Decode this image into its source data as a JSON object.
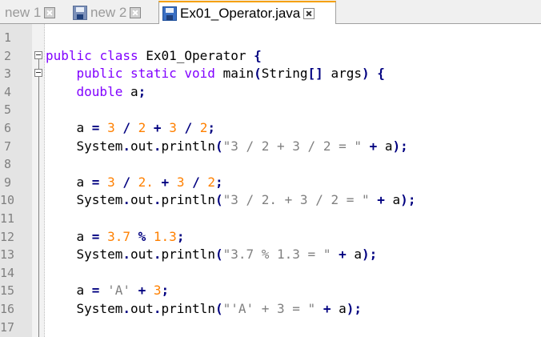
{
  "tabs": [
    {
      "label": "new 1",
      "icon": "close-icon",
      "active": false
    },
    {
      "label": "new 2",
      "icon": "save-icon",
      "active": false
    },
    {
      "label": "Ex01_Operator.java",
      "icon": "save-icon",
      "active": true
    }
  ],
  "editor": {
    "line_numbers": [
      "1",
      "2",
      "3",
      "4",
      "5",
      "6",
      "7",
      "8",
      "9",
      "10",
      "11",
      "12",
      "13",
      "14",
      "15",
      "16",
      "17"
    ],
    "code": {
      "l2": {
        "kw1": "public",
        "kw2": "class",
        "name": " Ex01_Operator ",
        "brace": "{"
      },
      "l3": {
        "kw1": "public",
        "kw2": "static",
        "kw3": "void",
        "name": " main",
        "p1": "(",
        "name2": "String",
        "br": "[]",
        "name3": " args",
        "p2": ")",
        "brace": "{"
      },
      "l4": {
        "kw": "double",
        "name": " a",
        "semi": ";"
      },
      "l6": {
        "a": "a ",
        "eq": "=",
        "n1": "3",
        "op1": "/",
        "n2": "2",
        "op2": "+",
        "n3": "3",
        "op3": "/",
        "n4": "2",
        "semi": ";"
      },
      "l7": {
        "name": "System",
        "dot1": ".",
        "name2": "out",
        "dot2": ".",
        "name3": "println",
        "p1": "(",
        "str": "\"3 / 2 + 3 / 2 = \"",
        "plus": "+",
        "a": " a",
        "p2": ")",
        "semi": ";"
      },
      "l9": {
        "a": "a ",
        "eq": "=",
        "n1": "3",
        "op1": "/",
        "n2": "2.",
        "op2": "+",
        "n3": "3",
        "op3": "/",
        "n4": "2",
        "semi": ";"
      },
      "l10": {
        "name": "System",
        "dot1": ".",
        "name2": "out",
        "dot2": ".",
        "name3": "println",
        "p1": "(",
        "str": "\"3 / 2. + 3 / 2 = \"",
        "plus": "+",
        "a": " a",
        "p2": ")",
        "semi": ";"
      },
      "l12": {
        "a": "a ",
        "eq": "=",
        "n1": "3.7",
        "op1": "%",
        "n2": "1.3",
        "semi": ";"
      },
      "l13": {
        "name": "System",
        "dot1": ".",
        "name2": "out",
        "dot2": ".",
        "name3": "println",
        "p1": "(",
        "str": "\"3.7 % 1.3 = \"",
        "plus": "+",
        "a": " a",
        "p2": ")",
        "semi": ";"
      },
      "l15": {
        "a": "a ",
        "eq": "=",
        "s1": "'A'",
        "plus": "+",
        "n1": "3",
        "semi": ";"
      },
      "l16": {
        "name": "System",
        "dot1": ".",
        "name2": "out",
        "dot2": ".",
        "name3": "println",
        "p1": "(",
        "str": "\"'A' + 3 = \"",
        "plus": "+",
        "a": " a",
        "p2": ")",
        "semi": ";"
      }
    }
  }
}
